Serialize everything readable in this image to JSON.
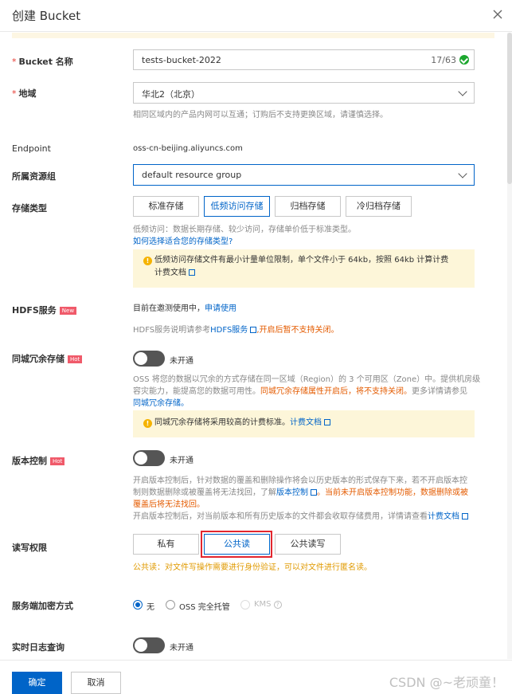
{
  "dialog": {
    "title": "创建 Bucket"
  },
  "bucket_name": {
    "label": "Bucket 名称",
    "value": "tests-bucket-2022",
    "count": "17/63"
  },
  "region": {
    "label": "地域",
    "value": "华北2（北京）",
    "hint": "相同区域内的产品内网可以互通；订购后不支持更换区域，请谨慎选择。"
  },
  "endpoint": {
    "label": "Endpoint",
    "value": "oss-cn-beijing.aliyuncs.com"
  },
  "resource_group": {
    "label": "所属资源组",
    "value": "default resource group"
  },
  "storage_type": {
    "label": "存储类型",
    "options": [
      "标准存储",
      "低频访问存储",
      "归档存储",
      "冷归档存储"
    ],
    "selected": "低频访问存储",
    "hint": "低频访问：数据长期存储、较少访问，存储单价低于标准类型。",
    "link": "如何选择适合您的存储类型?",
    "notice": "低频访问存储文件有最小计量单位限制，单个文件小于 64kb，按照 64kb 计算计费",
    "notice_link": "计费文档"
  },
  "hdfs": {
    "label": "HDFS服务",
    "tag": "New",
    "status_text": "目前在邀测使用中，",
    "apply_link": "申请使用",
    "hint_prefix": "HDFS服务说明请参考",
    "hint_link": "HDFS服务",
    "hint_warn": ",开启后暂不支持关闭。"
  },
  "zone_redundancy": {
    "label": "同城冗余存储",
    "tag": "Hot",
    "toggle_label": "未开通",
    "hint_1": "OSS 将您的数据以冗余的方式存储在同一区域（Region）的 3 个可用区（Zone）中。提供机房级",
    "hint_2a": "容灾能力，能提高您的数据可用性。",
    "hint_2warn": "同城冗余存储属性开启后，将不支持关闭。",
    "hint_2b": "更多详情请参见",
    "hint_link": "同城冗余存储。",
    "notice": "同城冗余存储将采用较高的计费标准。",
    "notice_link": "计费文档"
  },
  "versioning": {
    "label": "版本控制",
    "tag": "Hot",
    "toggle_label": "未开通",
    "hint_1": "开启版本控制后，针对数据的覆盖和删除操作将会以历史版本的形式保存下来，若不开启版本控",
    "hint_2a": "制则数据删除或被覆盖将无法找回，了解",
    "hint_2link": "版本控制",
    "hint_2warn": "。当前未开启版本控制功能，数据删除或被",
    "hint_3warn": "覆盖后将无法找回。",
    "hint_4a": "开启版本控制后，对当前版本和所有历史版本的文件都会收取存储费用，详情请查看",
    "hint_4link": "计费文档"
  },
  "acl": {
    "label": "读写权限",
    "options": [
      "私有",
      "公共读",
      "公共读写"
    ],
    "selected": "公共读",
    "warning": "公共读：对文件写操作需要进行身份验证，可以对文件进行匿名读。"
  },
  "encryption": {
    "label": "服务端加密方式",
    "options": [
      "无",
      "OSS 完全托管",
      "KMS"
    ],
    "selected": "无"
  },
  "realtime_log": {
    "label": "实时日志查询",
    "toggle_label": "未开通"
  },
  "footer": {
    "confirm": "确定",
    "cancel": "取消",
    "watermark": "CSDN @~老顽童！"
  }
}
